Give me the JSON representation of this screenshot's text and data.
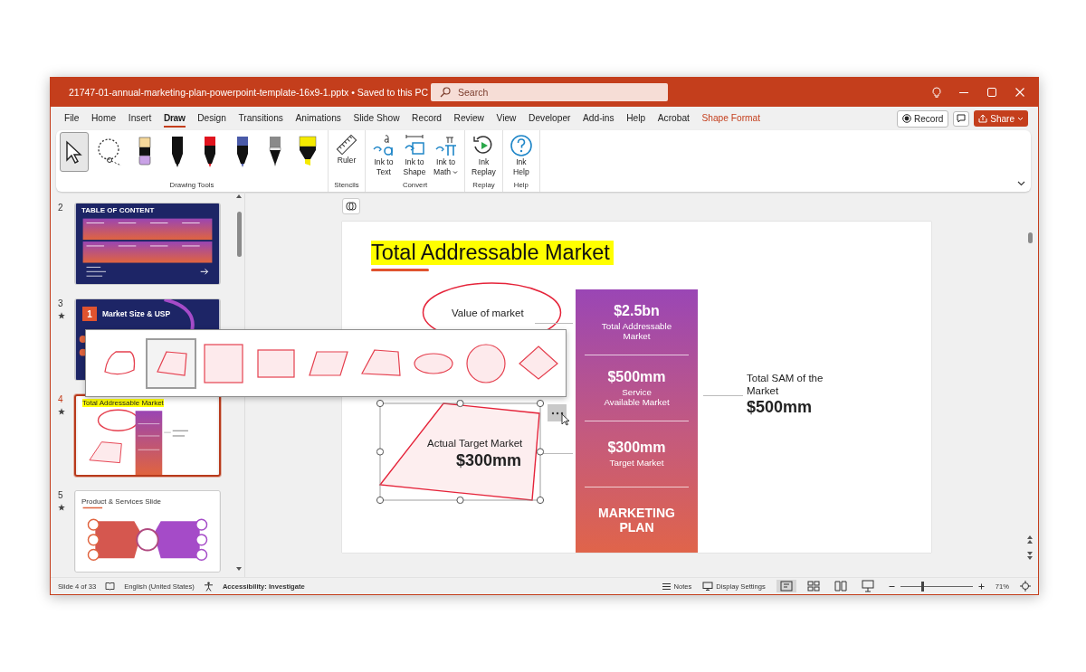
{
  "title_bar": {
    "document_title": "21747-01-annual-marketing-plan-powerpoint-template-16x9-1.pptx • Saved to this PC",
    "search": {
      "placeholder": "Search"
    }
  },
  "menu_tabs": [
    {
      "label": "File",
      "selected": false,
      "kind": "tab"
    },
    {
      "label": "Home",
      "selected": false,
      "kind": "tab"
    },
    {
      "label": "Insert",
      "selected": false,
      "kind": "tab"
    },
    {
      "label": "Draw",
      "selected": true,
      "kind": "tab"
    },
    {
      "label": "Design",
      "selected": false,
      "kind": "tab"
    },
    {
      "label": "Transitions",
      "selected": false,
      "kind": "tab"
    },
    {
      "label": "Animations",
      "selected": false,
      "kind": "tab"
    },
    {
      "label": "Slide Show",
      "selected": false,
      "kind": "tab"
    },
    {
      "label": "Record",
      "selected": false,
      "kind": "tab"
    },
    {
      "label": "Review",
      "selected": false,
      "kind": "tab"
    },
    {
      "label": "View",
      "selected": false,
      "kind": "tab"
    },
    {
      "label": "Developer",
      "selected": false,
      "kind": "tab"
    },
    {
      "label": "Add-ins",
      "selected": false,
      "kind": "tab"
    },
    {
      "label": "Help",
      "selected": false,
      "kind": "tab"
    },
    {
      "label": "Acrobat",
      "selected": false,
      "kind": "tab"
    },
    {
      "label": "Shape Format",
      "selected": false,
      "kind": "contextual"
    }
  ],
  "header_buttons": [
    {
      "kind": "record",
      "label": "Record"
    },
    {
      "kind": "comments"
    },
    {
      "kind": "share",
      "label": "Share"
    }
  ],
  "ribbon": [
    {
      "name": "Drawing Tools",
      "tools": [
        {
          "kind": "select",
          "selected": true
        },
        {
          "kind": "lasso",
          "selected": false
        },
        {
          "kind": "eraser",
          "selected": false
        },
        {
          "kind": "pen",
          "color": "#111111",
          "selected": false
        },
        {
          "kind": "pen",
          "color": "#e0141e",
          "selected": false
        },
        {
          "kind": "pen",
          "color": "#4a5aa8",
          "selected": false
        },
        {
          "kind": "pencil",
          "color": "#8a8a8a",
          "selected": false
        },
        {
          "kind": "highlighter",
          "color": "#f5ea00",
          "selected": false
        }
      ]
    },
    {
      "name": "Stencils",
      "buttons": [
        {
          "kind": "ruler",
          "label": "Ruler",
          "dropdown": false
        }
      ]
    },
    {
      "name": "Convert",
      "buttons": [
        {
          "kind": "ink-text",
          "label": "Ink to\nText",
          "dropdown": false
        },
        {
          "kind": "ink-shape",
          "label": "Ink to\nShape",
          "dropdown": false
        },
        {
          "kind": "ink-math",
          "label": "Ink to\nMath",
          "dropdown": true
        }
      ]
    },
    {
      "name": "Replay",
      "buttons": [
        {
          "kind": "replay",
          "label": "Ink\nReplay",
          "dropdown": false
        }
      ]
    },
    {
      "name": "Help",
      "buttons": [
        {
          "kind": "help",
          "label": "Ink\nHelp",
          "dropdown": false
        }
      ]
    }
  ],
  "slides": [
    {
      "number": "2",
      "starred": false,
      "selected": false,
      "kind": "toc",
      "title": "TABLE OF CONTENT"
    },
    {
      "number": "3",
      "starred": true,
      "selected": false,
      "kind": "section",
      "badge": "1",
      "title": "Market Size & USP"
    },
    {
      "number": "4",
      "starred": true,
      "selected": true,
      "kind": "highlight",
      "title": "Total Addressable Market"
    },
    {
      "number": "5",
      "starred": true,
      "selected": false,
      "kind": "product",
      "title": "Product & Services Slide"
    }
  ],
  "slide": {
    "title": "Total Addressable Market",
    "value_bubble": {
      "label": "Value of market"
    },
    "market_column": [
      {
        "kind": "metric",
        "value": "$2.5bn",
        "label": "Total Addressable\nMarket"
      },
      {
        "kind": "metric",
        "value": "$500mm",
        "label": "Service\nAvailable Market"
      },
      {
        "kind": "metric",
        "value": "$300mm",
        "label": "Target Market"
      },
      {
        "kind": "heading",
        "value": "MARKETING\nPLAN"
      }
    ],
    "sam_note": {
      "label": "Total SAM of the\nMarket",
      "value": "$500mm"
    },
    "target_shape": {
      "label": "Actual Target Market",
      "value": "$300mm",
      "selected": true
    }
  },
  "shape_picker": [
    {
      "kind": "freeform",
      "selected": false
    },
    {
      "kind": "skewed-quad",
      "selected": true
    },
    {
      "kind": "square",
      "selected": false
    },
    {
      "kind": "rectangle",
      "selected": false
    },
    {
      "kind": "parallelogram",
      "selected": false
    },
    {
      "kind": "trapezoid",
      "selected": false
    },
    {
      "kind": "ellipse",
      "selected": false
    },
    {
      "kind": "circle",
      "selected": false
    },
    {
      "kind": "diamond",
      "selected": false
    }
  ],
  "status_bar": {
    "slide_info": "Slide 4 of 33",
    "language": "English (United States)",
    "accessibility": "Accessibility: Investigate",
    "notes": "Notes",
    "display_settings": "Display Settings",
    "views": [
      {
        "kind": "normal",
        "selected": true
      },
      {
        "kind": "sorter",
        "selected": false
      },
      {
        "kind": "reading",
        "selected": false
      },
      {
        "kind": "slideshow",
        "selected": false
      }
    ],
    "zoom": {
      "level": 0.3,
      "reading": "71%"
    }
  }
}
